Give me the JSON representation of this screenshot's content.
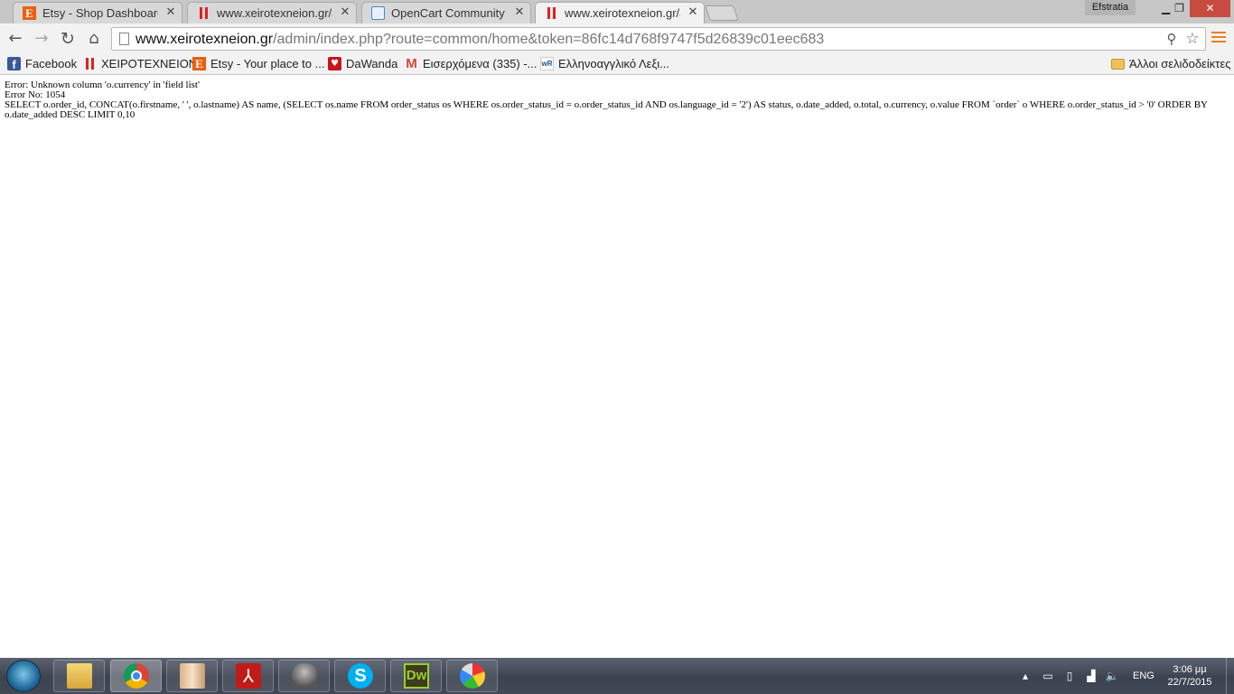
{
  "browser": {
    "tabs": [
      {
        "title": "Etsy - Shop Dashboard",
        "icon": "etsy-icon"
      },
      {
        "title": "www.xeirotexneion.gr/adm",
        "icon": "xeirotexneion-icon"
      },
      {
        "title": "OpenCart Community • Vi",
        "icon": "opencart-icon"
      },
      {
        "title": "www.xeirotexneion.gr/adm",
        "icon": "xeirotexneion-icon",
        "active": true
      }
    ],
    "profile_name": "Efstratia",
    "url": {
      "host": "www.xeirotexneion.gr",
      "path": "/admin/index.php?route=common/home&token=86fc14d768f9747f5d26839c01eec683"
    },
    "bookmarks": [
      {
        "label": "Facebook",
        "icon": "facebook-icon"
      },
      {
        "label": "ΧΕΙΡΟΤΕΧΝΕΙΟΝ",
        "icon": "xeirotexneion-icon"
      },
      {
        "label": "Etsy - Your place to ...",
        "icon": "etsy-icon"
      },
      {
        "label": "DaWanda",
        "icon": "dawanda-icon"
      },
      {
        "label": "Εισερχόμενα (335) -...",
        "icon": "gmail-icon"
      },
      {
        "label": "Ελληνοαγγλικό Λεξι...",
        "icon": "wordreference-icon"
      }
    ],
    "other_bookmarks": "Άλλοι σελιδοδείκτες",
    "accent_color": "#e8811d"
  },
  "page": {
    "error_line": "Error: Unknown column 'o.currency' in 'field list'",
    "error_no": "Error No: 1054",
    "sql": "SELECT o.order_id, CONCAT(o.firstname, ' ', o.lastname) AS name, (SELECT os.name FROM order_status os WHERE os.order_status_id = o.order_status_id AND os.language_id = '2') AS status, o.date_added, o.total, o.currency, o.value FROM `order` o WHERE o.order_status_id > '0' ORDER BY o.date_added DESC LIMIT 0,10"
  },
  "taskbar": {
    "apps": [
      "windows-explorer-icon",
      "chrome-icon",
      "winrar-icon",
      "acrobat-icon",
      "warrior-icon",
      "skype-icon",
      "dreamweaver-icon",
      "paint-icon"
    ],
    "dreamweaver_label": "Dw",
    "skype_label": "S",
    "language": "ENG",
    "time": "3:06 μμ",
    "date": "22/7/2015"
  }
}
